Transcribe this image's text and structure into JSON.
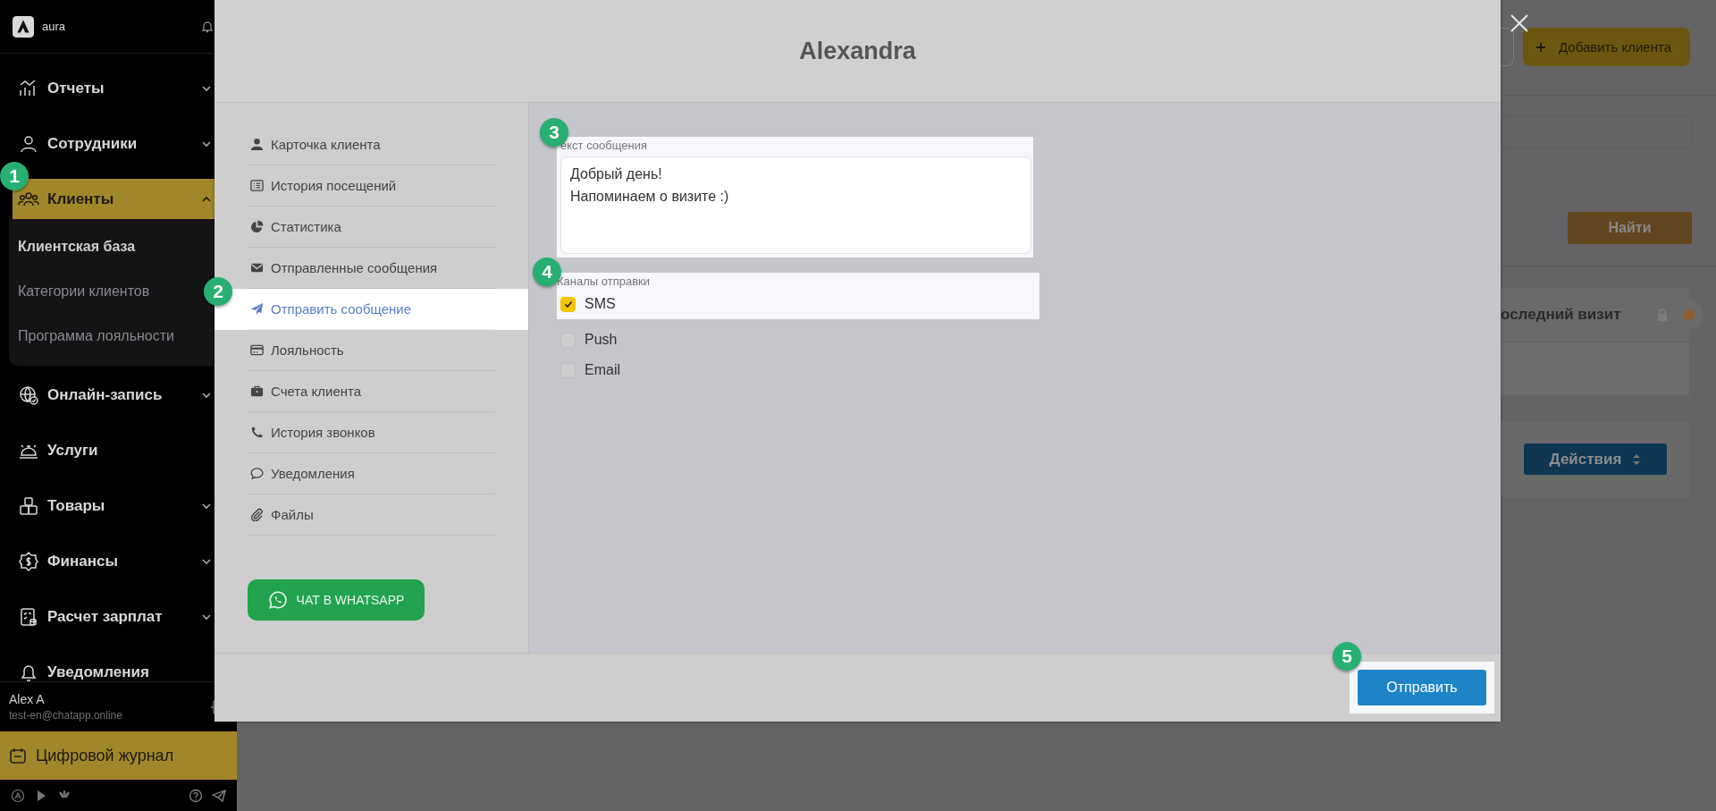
{
  "sidebar": {
    "brand": "aura",
    "menu": [
      {
        "label": "Отчеты",
        "kind": "group",
        "expanded": false,
        "selected": false
      },
      {
        "label": "Сотрудники",
        "kind": "group",
        "expanded": false,
        "selected": false
      },
      {
        "label": "Клиенты",
        "kind": "group",
        "expanded": true,
        "selected": true,
        "step": "1",
        "children": [
          {
            "label": "Клиентская база",
            "selected": true
          },
          {
            "label": "Категории клиентов",
            "selected": false
          },
          {
            "label": "Программа лояльности",
            "selected": false
          }
        ]
      },
      {
        "label": "Онлайн-запись",
        "kind": "group",
        "expanded": false,
        "selected": false
      },
      {
        "label": "Услуги",
        "kind": "link",
        "selected": false
      },
      {
        "label": "Товары",
        "kind": "group",
        "expanded": false,
        "selected": false
      },
      {
        "label": "Финансы",
        "kind": "group",
        "expanded": false,
        "selected": false
      },
      {
        "label": "Расчет зарплат",
        "kind": "group",
        "expanded": false,
        "selected": false
      },
      {
        "label": "Уведомления",
        "kind": "link",
        "selected": false
      }
    ],
    "user": {
      "name": "Alex A",
      "email": "test-en@chatapp.online"
    },
    "journal_button": "Цифровой журнал"
  },
  "page": {
    "add_button": "Добавить клиента",
    "search_button": "Найти",
    "table_header": "оследний визит",
    "actions_button": "Действия"
  },
  "modal": {
    "title": "Alexandra",
    "nav": [
      {
        "label": "Карточка клиента",
        "selected": false
      },
      {
        "label": "История посещений",
        "selected": false
      },
      {
        "label": "Статистика",
        "selected": false
      },
      {
        "label": "Отправленные сообщения",
        "selected": false
      },
      {
        "label": "Отправить сообщение",
        "selected": true,
        "step": "2"
      },
      {
        "label": "Лояльность",
        "selected": false
      },
      {
        "label": "Счета клиента",
        "selected": false
      },
      {
        "label": "История звонков",
        "selected": false
      },
      {
        "label": "Уведомления",
        "selected": false
      },
      {
        "label": "Файлы",
        "selected": false
      }
    ],
    "whatsapp_button": "ЧАТ В WHATSAPP",
    "message_field": {
      "label": "екст сообщения",
      "value": "Добрый день!\nНапоминаем о визите :)",
      "step": "3"
    },
    "channels": {
      "label": "Каналы отправки",
      "step": "4",
      "options": [
        {
          "label": "SMS",
          "checked": true
        },
        {
          "label": "Push",
          "checked": false
        },
        {
          "label": "Email",
          "checked": false
        }
      ]
    },
    "send_button": {
      "label": "Отправить",
      "step": "5"
    }
  }
}
